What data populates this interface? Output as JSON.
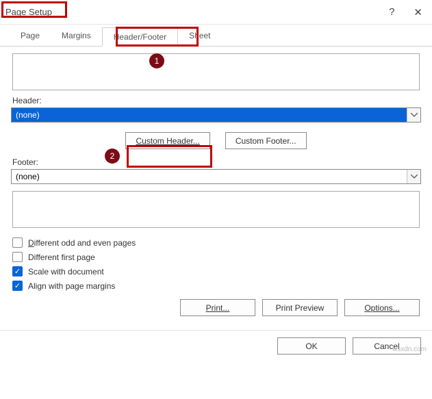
{
  "title": "Page Setup",
  "help_symbol": "?",
  "close_symbol": "✕",
  "tabs": {
    "page": "Page",
    "margins": "Margins",
    "headerfooter": "Header/Footer",
    "sheet": "Sheet"
  },
  "labels": {
    "header": "Header:",
    "footer": "Footer:"
  },
  "header_select": "(none)",
  "footer_select": "(none)",
  "buttons": {
    "custom_header": "Custom Header...",
    "custom_footer": "Custom Footer...",
    "print": "Print...",
    "print_preview": "Print Preview",
    "options": "Options...",
    "ok": "OK",
    "cancel": "Cancel"
  },
  "checks": {
    "diff_odd_even": "Different odd and even pages",
    "diff_first": "Different first page",
    "scale_doc": "Scale with document",
    "align_margins": "Align with page margins"
  },
  "annotations": {
    "badge1": "1",
    "badge2": "2"
  },
  "watermark": "wsxdn.com"
}
